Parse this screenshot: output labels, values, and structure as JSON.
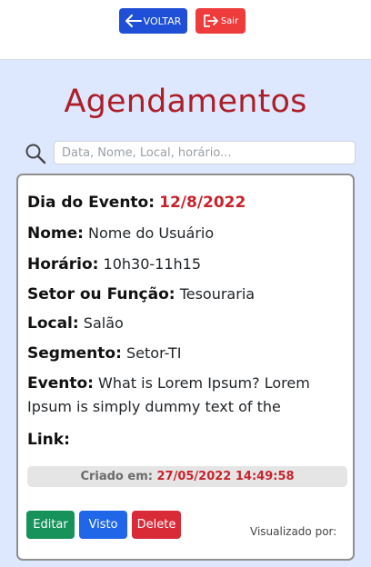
{
  "header": {
    "back_label": "VOLTAR",
    "exit_label": "Sair",
    "colors": {
      "back": "#1f4fd6",
      "exit": "#ee3b3b"
    }
  },
  "page": {
    "title": "Agendamentos"
  },
  "search": {
    "placeholder": "Data, Nome, Local, horário...",
    "value": ""
  },
  "card": {
    "date_label": "Dia do Evento:",
    "date_value": "12/8/2022",
    "name_label": "Nome:",
    "name_value": "Nome do Usuário",
    "time_label": "Horário:",
    "time_value": "10h30-11h15",
    "sector_label": "Setor ou Função:",
    "sector_value": "Tesouraria",
    "place_label": "Local:",
    "place_value": "Salão",
    "segment_label": "Segmento:",
    "segment_value": "Setor-TI",
    "event_label": "Evento:",
    "event_value": "What is Lorem Ipsum? Lorem Ipsum is simply dummy text of the",
    "link_label": "Link:",
    "created_label": "Criado em:",
    "created_value": "27/05/2022 14:49:58",
    "edit_label": "Editar",
    "seen_label": "Visto",
    "delete_label": "Delete",
    "viewed_by": "Visualizado por:"
  }
}
